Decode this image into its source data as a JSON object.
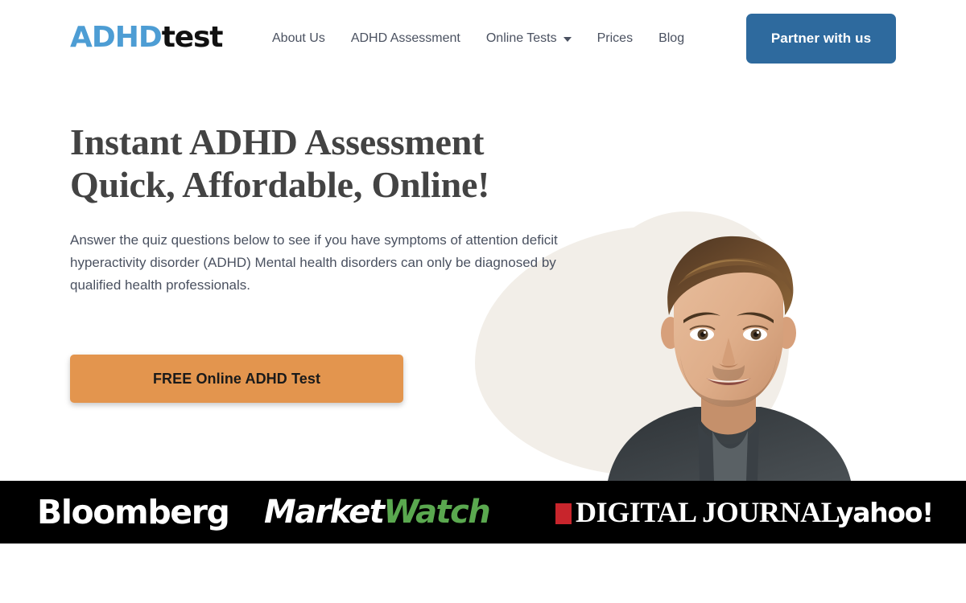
{
  "brand": {
    "logo_primary": "ADHD",
    "logo_secondary": "test",
    "logo_primary_color": "#4D9DD4",
    "logo_secondary_color": "#111111"
  },
  "header": {
    "nav": [
      {
        "label": "About Us",
        "has_dropdown": false
      },
      {
        "label": "ADHD Assessment",
        "has_dropdown": false
      },
      {
        "label": "Online Tests",
        "has_dropdown": true
      },
      {
        "label": "Prices",
        "has_dropdown": false
      },
      {
        "label": "Blog",
        "has_dropdown": false
      }
    ],
    "cta": {
      "label": "Partner with us",
      "background": "#2E6A9E",
      "text_color": "#FFFFFF"
    }
  },
  "hero": {
    "headline_line1": "Instant ADHD Assessment",
    "headline_line2": "Quick, Affordable, Online!",
    "headline_color": "#434343",
    "subcopy": "Answer the quiz questions below to see if you have symptoms of attention deficit hyperactivity disorder (ADHD) Mental health disorders can only be diagnosed by qualified health professionals.",
    "subcopy_color": "#4A5160",
    "cta": {
      "label": "FREE Online ADHD Test",
      "background": "#E3954E",
      "text_color": "#1A1A1A"
    },
    "artwork": {
      "blob_color": "#F2EEE8",
      "image_alt": "smiling man portrait"
    }
  },
  "press_bar": {
    "background": "#000000",
    "logos": [
      {
        "name": "bloomberg",
        "text": "Bloomberg"
      },
      {
        "name": "marketwatch",
        "text_part1": "Market",
        "text_part2": "Watch",
        "accent_color": "#5AA84F"
      },
      {
        "name": "digital-journal",
        "text": "DIGITAL JOURNAL",
        "mark_color": "#C8252C"
      },
      {
        "name": "yahoo",
        "text": "yahoo!"
      }
    ]
  }
}
